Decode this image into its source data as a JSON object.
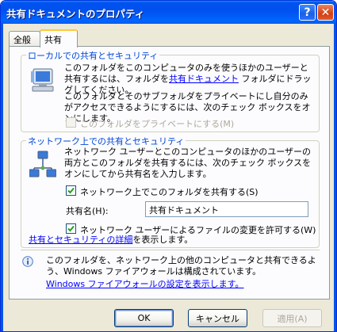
{
  "window": {
    "title": "共有ドキュメントのプロパティ",
    "help_label": "?",
    "close_label": "✕"
  },
  "tabs": [
    {
      "label": "全般"
    },
    {
      "label": "共有"
    }
  ],
  "local_group": {
    "label": "ローカルでの共有とセキュリティ",
    "text1_before_link": "このフォルダをこのコンピュータのみを使うほかのユーザーと共有するには、フォルダを",
    "text1_link": "共有ドキュメント",
    "text1_after_link": " フォルダにドラッグしてください。",
    "text2": "このフォルダとそのサブフォルダをプライベートにし自分のみがアクセスできるようにするには、次のチェック ボックスをオンにします。",
    "private_checkbox_label": "このフォルダをプライベートにする(M)",
    "private_checked": false
  },
  "network_group": {
    "label": "ネットワーク上での共有とセキュリティ",
    "text": "ネットワーク ユーザーとこのコンピュータのほかのユーザーの両方とこのフォルダを共有するには、次のチェック ボックスをオンにしてから共有名を入力します。",
    "share_checkbox_label": "ネットワーク上でこのフォルダを共有する(S)",
    "share_checked": true,
    "share_name_label": "共有名(H):",
    "share_name_value": "共有ドキュメント",
    "allow_change_label": "ネットワーク ユーザーによるファイルの変更を許可する(W)",
    "allow_change_checked": true,
    "details_link": "共有とセキュリティの詳細",
    "details_suffix": "を表示します。"
  },
  "firewall": {
    "text": "このフォルダを、ネットワーク上の他のコンピュータと共有できるよう、Windows ファイアウォールは構成されています。",
    "link": "Windows ファイアウォールの設定を表示します。"
  },
  "buttons": {
    "ok": "OK",
    "cancel": "キャンセル",
    "apply": "適用(A)"
  },
  "colors": {
    "titlebar": "#0054e3",
    "group_label": "#0046d5",
    "link": "#0000ff"
  }
}
